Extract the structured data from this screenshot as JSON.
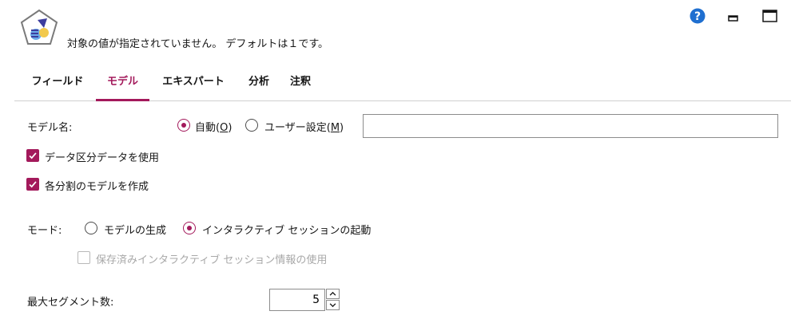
{
  "header": {
    "warning_text": "対象の値が指定されていません。 デフォルトは１です。",
    "icons": [
      "node-icon",
      "help-icon",
      "minimize-icon",
      "maximize-icon"
    ]
  },
  "tabs": [
    {
      "label": "フィールド",
      "active": false
    },
    {
      "label": "モデル",
      "active": true
    },
    {
      "label": "エキスパート",
      "active": false
    },
    {
      "label": "分析",
      "active": false
    },
    {
      "label": "注釈",
      "active": false
    }
  ],
  "model_name": {
    "label": "モデル名:",
    "auto_label": "自動(",
    "auto_key": "O",
    "custom_label": "ユーザー設定(",
    "custom_key": "M",
    "close_paren": ")",
    "selected": "auto",
    "value": ""
  },
  "use_partitioned_data": {
    "label": "データ区分データを使用",
    "checked": true
  },
  "build_per_split": {
    "label": "各分割のモデルを作成",
    "checked": true
  },
  "mode": {
    "label": "モード:",
    "options": [
      "モデルの生成",
      "インタラクティブ セッションの起動"
    ],
    "selected": "インタラクティブ セッションの起動"
  },
  "use_saved_session": {
    "label": "保存済みインタラクティブ セッション情報の使用",
    "checked": false,
    "disabled": true
  },
  "max_segments": {
    "label": "最大セグメント数:",
    "value": "5"
  },
  "colors": {
    "accent": "#a3195b",
    "help_blue": "#1f6fd0"
  }
}
